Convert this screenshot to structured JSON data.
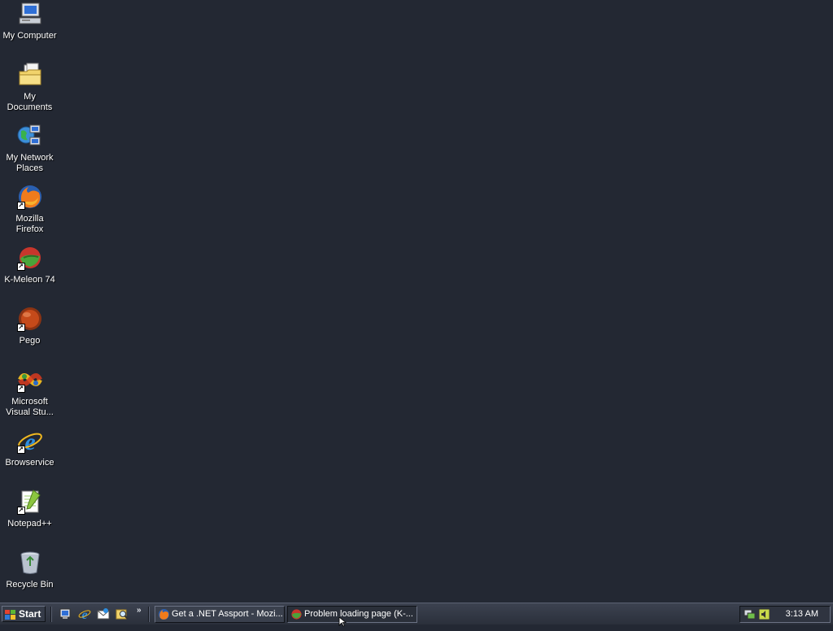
{
  "desktop": {
    "icons": [
      {
        "label": "My Computer",
        "icon": "my-computer-icon"
      },
      {
        "label": "My Documents",
        "icon": "my-documents-icon"
      },
      {
        "label": "My Network\nPlaces",
        "icon": "network-places-icon"
      },
      {
        "label": "Mozilla Firefox",
        "icon": "firefox-icon"
      },
      {
        "label": "K-Meleon 74",
        "icon": "k-meleon-icon"
      },
      {
        "label": "Pego",
        "icon": "pego-icon"
      },
      {
        "label": "Microsoft\nVisual Stu...",
        "icon": "visual-studio-icon"
      },
      {
        "label": "Browservice",
        "icon": "internet-explorer-icon"
      },
      {
        "label": "Notepad++",
        "icon": "notepad-plus-plus-icon"
      },
      {
        "label": "Recycle Bin",
        "icon": "recycle-bin-icon"
      }
    ]
  },
  "taskbar": {
    "start_label": "Start",
    "quick_launch": [
      {
        "icon": "show-desktop-icon"
      },
      {
        "icon": "internet-explorer-icon"
      },
      {
        "icon": "outlook-express-icon"
      },
      {
        "icon": "search-icon"
      }
    ],
    "quick_launch_more": "»",
    "tasks": [
      {
        "label": "Get a .NET Assport - Mozi...",
        "icon": "firefox-icon",
        "active": false
      },
      {
        "label": "Problem loading page (K-...",
        "icon": "k-meleon-icon",
        "active": true
      }
    ],
    "tray": {
      "icons": [
        {
          "icon": "network-tray-icon"
        },
        {
          "icon": "volume-tray-icon"
        }
      ],
      "clock": "3:13 AM"
    }
  },
  "colors": {
    "desktop_background": "#232833",
    "taskbar": "#343a47",
    "label_text": "#ffffff"
  }
}
